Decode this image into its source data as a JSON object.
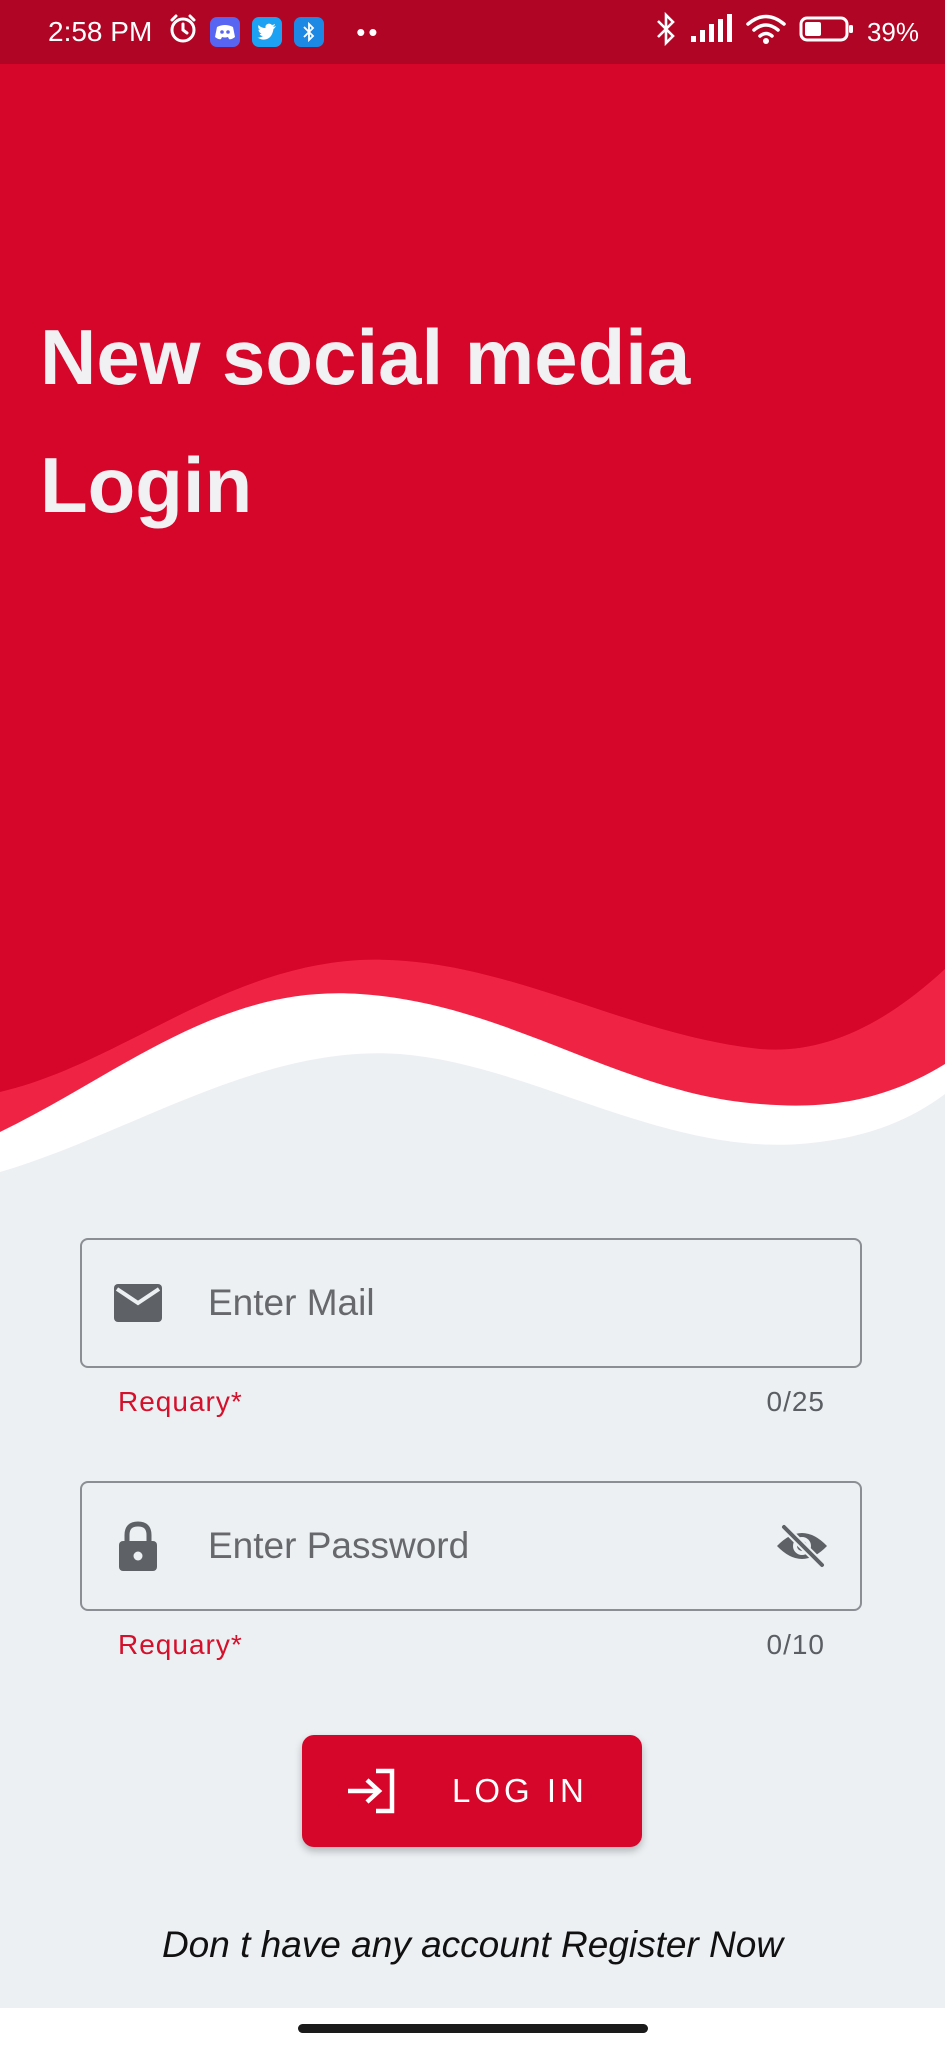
{
  "status_bar": {
    "time": "2:58 PM",
    "battery_percent": "39%",
    "notification_icons": [
      "alarm-icon",
      "discord-icon",
      "twitter-icon",
      "bluetooth-app-icon",
      "more-dots-icon"
    ],
    "system_icons": [
      "bluetooth-icon",
      "signal-icon",
      "wifi-icon",
      "battery-icon"
    ]
  },
  "header": {
    "title_line1": "New social media",
    "title_line2": "Login"
  },
  "form": {
    "email": {
      "placeholder": "Enter Mail",
      "value": "",
      "helper_text": "Requary*",
      "counter": "0/25",
      "icon": "mail-icon"
    },
    "password": {
      "placeholder": "Enter Password",
      "value": "",
      "helper_text": "Requary*",
      "counter": "0/10",
      "icon": "lock-icon",
      "toggle_icon": "eye-off-icon"
    },
    "login_button": {
      "label": "LOG IN",
      "icon": "login-icon"
    },
    "register_prompt": "Don t have any account Register Now"
  },
  "colors": {
    "header_red": "#D6052A",
    "wave_accent": "#EF2444",
    "status_bar": "#B00524",
    "background": "#ECF0F3",
    "error_red": "#D4102B"
  }
}
